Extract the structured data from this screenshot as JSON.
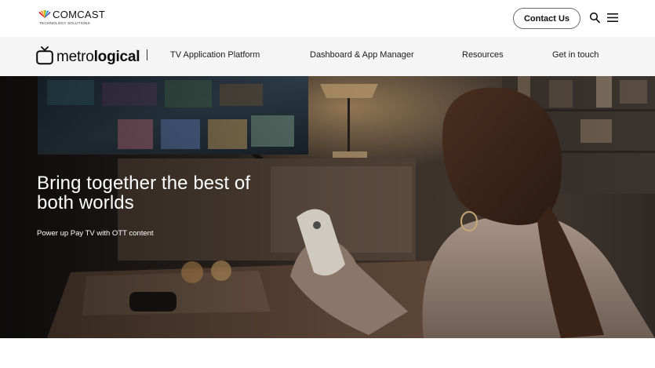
{
  "header": {
    "brand": "COMCAST",
    "brand_sub": "TECHNOLOGY SOLUTIONS",
    "contact_label": "Contact Us",
    "search_icon": "search-icon",
    "menu_icon": "hamburger-menu-icon"
  },
  "subnav": {
    "logo_regular": "metro",
    "logo_bold": "logical",
    "logo_tm": "™",
    "items": [
      {
        "label": "TV Application Platform"
      },
      {
        "label": "Dashboard & App Manager"
      },
      {
        "label": "Resources"
      },
      {
        "label": "Get in touch"
      }
    ]
  },
  "hero": {
    "title": "Bring together the best of both worlds",
    "subtitle": "Power up Pay TV with OTT content"
  },
  "colors": {
    "subnav_bg": "#f5f5f6",
    "text_dark": "#111111",
    "hero_text": "#ffffff"
  }
}
